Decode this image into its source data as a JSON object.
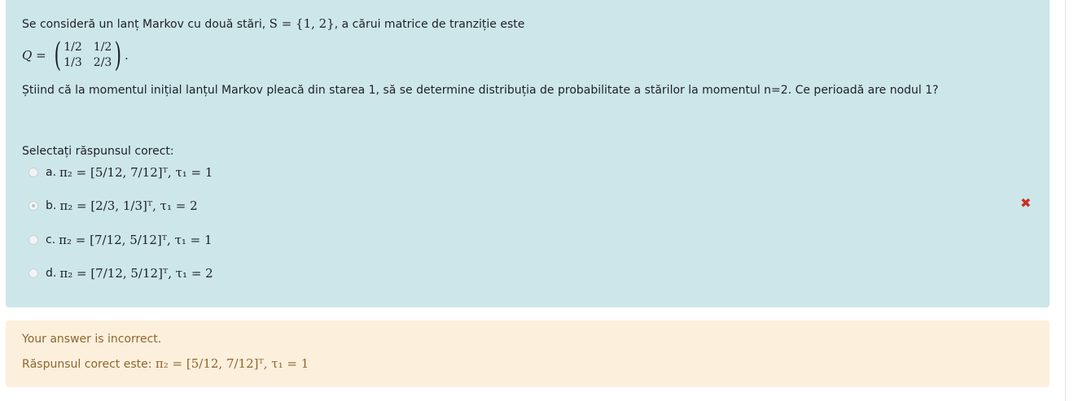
{
  "question": {
    "intro_text": "Se consideră un lanț Markov cu două stări,",
    "intro_math": "S = {1, 2}",
    "intro_tail": ", a cărui matrice de tranziție este",
    "matrix_lhs": "Q =",
    "matrix": [
      [
        "1/2",
        "1/2"
      ],
      [
        "1/3",
        "2/3"
      ]
    ],
    "matrix_tail": ".",
    "body": "Știind că la momentul inițial lanțul Markov pleacă din starea 1, să se determine distribuția de probabilitate a stărilor la momentul n=2. Ce perioadă are nodul 1?",
    "prompt": "Selectați răspunsul corect:",
    "options": [
      {
        "letter": "a.",
        "math": "π₂ = [5/12, 7/12]ᵀ, τ₁ = 1",
        "selected": false
      },
      {
        "letter": "b.",
        "math": "π₂ = [2/3, 1/3]ᵀ, τ₁ = 2",
        "selected": true
      },
      {
        "letter": "c.",
        "math": "π₂ = [7/12, 5/12]ᵀ, τ₁ = 1",
        "selected": false
      },
      {
        "letter": "d.",
        "math": "π₂ = [7/12, 5/12]ᵀ, τ₁ = 2",
        "selected": false
      }
    ],
    "incorrect_mark": "✖"
  },
  "feedback": {
    "status": "Your answer is incorrect.",
    "correct_label": "Răspunsul corect este:",
    "correct_math": "π₂ = [5/12, 7/12]ᵀ, τ₁ = 1"
  },
  "colors": {
    "question_bg": "#cde6ea",
    "feedback_bg": "#fcefdc",
    "feedback_text": "#8e662e",
    "incorrect": "#ca3120"
  }
}
